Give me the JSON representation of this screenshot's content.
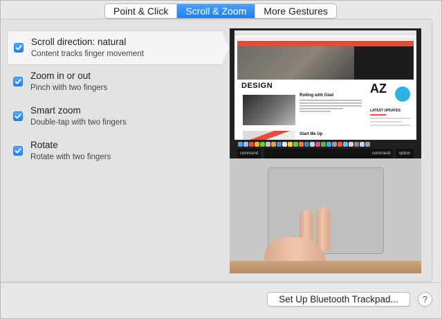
{
  "tabs": [
    {
      "label": "Point & Click",
      "active": false
    },
    {
      "label": "Scroll & Zoom",
      "active": true
    },
    {
      "label": "More Gestures",
      "active": false
    }
  ],
  "options": [
    {
      "title": "Scroll direction: natural",
      "description": "Content tracks finger movement",
      "checked": true,
      "selected": true
    },
    {
      "title": "Zoom in or out",
      "description": "Pinch with two fingers",
      "checked": true,
      "selected": false
    },
    {
      "title": "Smart zoom",
      "description": "Double-tap with two fingers",
      "checked": true,
      "selected": false
    },
    {
      "title": "Rotate",
      "description": "Rotate with two fingers",
      "checked": true,
      "selected": false
    }
  ],
  "preview": {
    "site_section": "DESIGN",
    "article_title": "Rolling with Glad",
    "second_article": "Start Me Up",
    "badge": "AZ",
    "sidebar_heading": "LATEST UPDATES",
    "keys": {
      "left": "command",
      "right_cmd": "command",
      "right_opt": "option"
    }
  },
  "footer": {
    "setup_button": "Set Up Bluetooth Trackpad...",
    "help_button": "?"
  },
  "colors": {
    "accent": "#1d7ff3",
    "site_red": "#e64c3d"
  }
}
